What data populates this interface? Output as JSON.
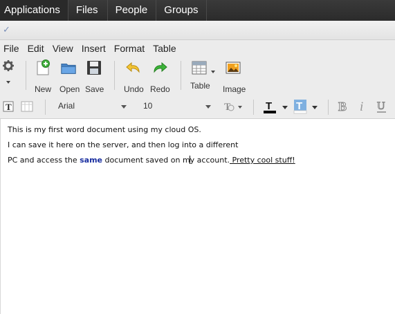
{
  "topbar": {
    "items": [
      {
        "label": "Applications"
      },
      {
        "label": "Files"
      },
      {
        "label": "People"
      },
      {
        "label": "Groups"
      }
    ]
  },
  "window": {
    "icon": "checkmark-app-icon"
  },
  "menubar": {
    "items": [
      {
        "label": "File"
      },
      {
        "label": "Edit"
      },
      {
        "label": "View"
      },
      {
        "label": "Insert"
      },
      {
        "label": "Format"
      },
      {
        "label": "Table"
      }
    ]
  },
  "toolbar": {
    "settings_icon": "gear-icon",
    "new_label": "New",
    "open_label": "Open",
    "save_label": "Save",
    "undo_label": "Undo",
    "redo_label": "Redo",
    "table_label": "Table",
    "image_label": "Image"
  },
  "format": {
    "font_family": "Arial",
    "font_size": "10",
    "text_color": "#000000",
    "highlight_color": "#ffffff"
  },
  "document": {
    "line1": "This is my first word document using my cloud OS.",
    "line2": "I can save it here on the server, and then log into a different",
    "line3_a": "PC and access the ",
    "line3_bold": "same",
    "line3_b": " document saved on m",
    "line3_c": "y account.",
    "line3_underline": " Pretty cool stuff!"
  },
  "colors": {
    "topbar": "#2b2b2b",
    "toolbar_bg": "#ececec",
    "bold_text": "#1a2fa0"
  }
}
